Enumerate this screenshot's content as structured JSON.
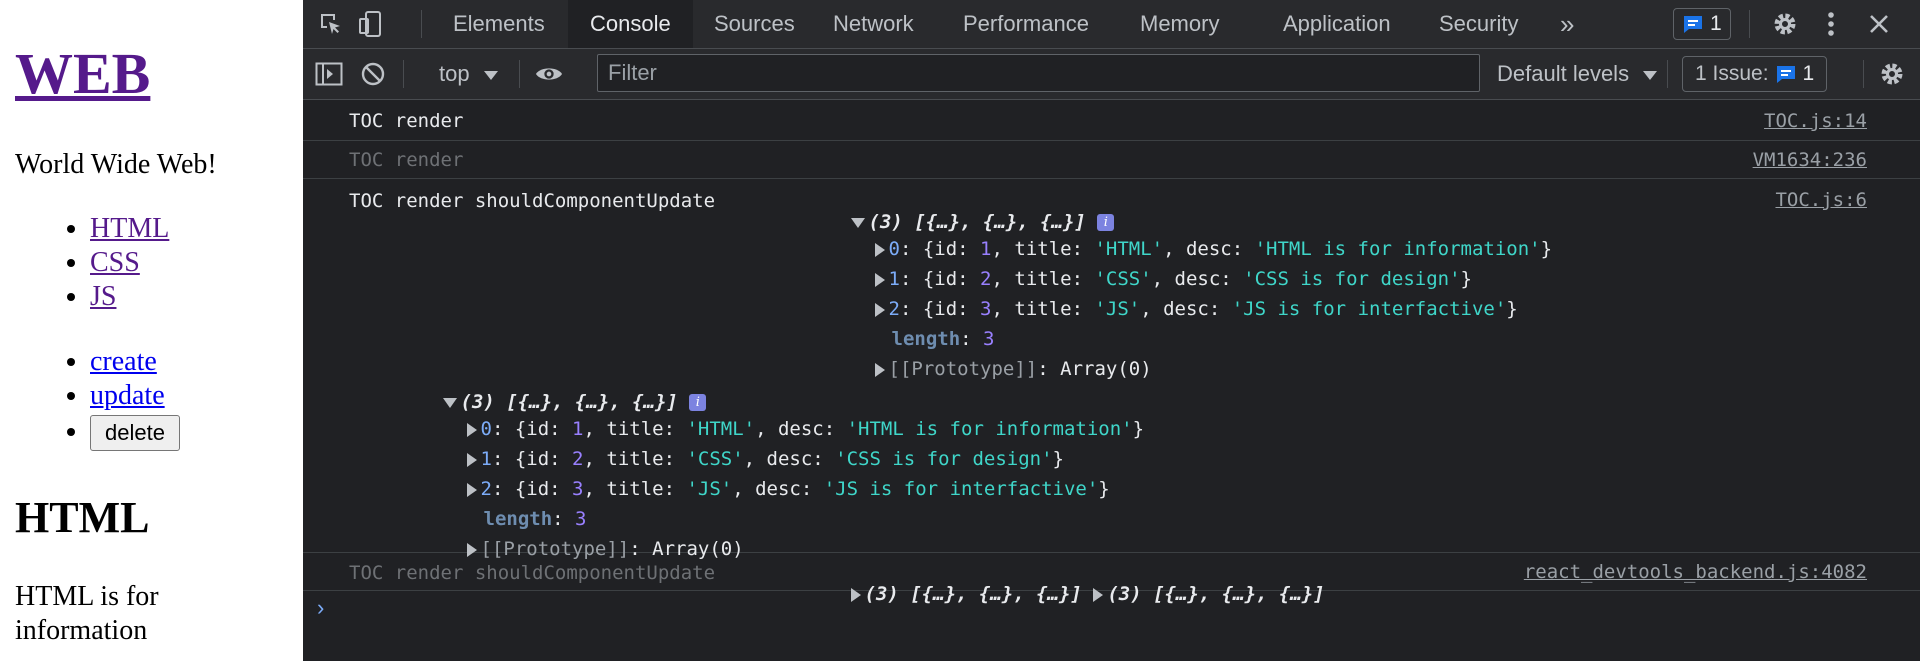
{
  "page": {
    "title": "WEB",
    "subtitle": "World Wide Web!",
    "toc": [
      "HTML",
      "CSS",
      "JS"
    ],
    "controls": {
      "create": "create",
      "update": "update",
      "delete": "delete"
    },
    "article_title": "HTML",
    "article_desc": "HTML is for information"
  },
  "devtools": {
    "tabs": [
      "Elements",
      "Console",
      "Sources",
      "Network",
      "Performance",
      "Memory",
      "Application",
      "Security"
    ],
    "active_tab": "Console",
    "more_tabs": "»",
    "message_badge": "1",
    "toolbar": {
      "context": "top",
      "filter_placeholder": "Filter",
      "levels": "Default levels",
      "issues_label": "1 Issue:",
      "issues_count": "1"
    },
    "messages": {
      "m1": {
        "text": "TOC render",
        "source": "TOC.js:14"
      },
      "m2": {
        "text": "TOC render",
        "source": "VM1634:236"
      },
      "m3": {
        "text": "TOC render shouldComponentUpdate",
        "summary": "(3) [{…}, {…}, {…}]",
        "source": "TOC.js:6"
      },
      "m4": {
        "text": "TOC render shouldComponentUpdate",
        "summary1": "(3) [{…}, {…}, {…}]",
        "summary2": "(3) [{…}, {…}, {…}]",
        "source": "react_devtools_backend.js:4082"
      }
    },
    "array_summary": "(3) [{…}, {…}, {…}]",
    "items": [
      {
        "index": "0",
        "id": "1",
        "title": "'HTML'",
        "desc": "'HTML is for information'"
      },
      {
        "index": "1",
        "id": "2",
        "title": "'CSS'",
        "desc": "'CSS is for design'"
      },
      {
        "index": "2",
        "id": "3",
        "title": "'JS'",
        "desc": "'JS is for interfactive'"
      }
    ],
    "length_label": "length",
    "length_value": "3",
    "prototype": "[[Prototype]]",
    "prototype_value": "Array(0)",
    "prompt": "›"
  },
  "colors": {
    "devtools_bg": "#202124",
    "toolbar_bg": "#292a2d",
    "link_visited": "#551a8b",
    "link": "#0000ee",
    "string_value": "#3fd6c9",
    "number_value": "#9980ff",
    "badge_blue": "#1a73e8"
  }
}
